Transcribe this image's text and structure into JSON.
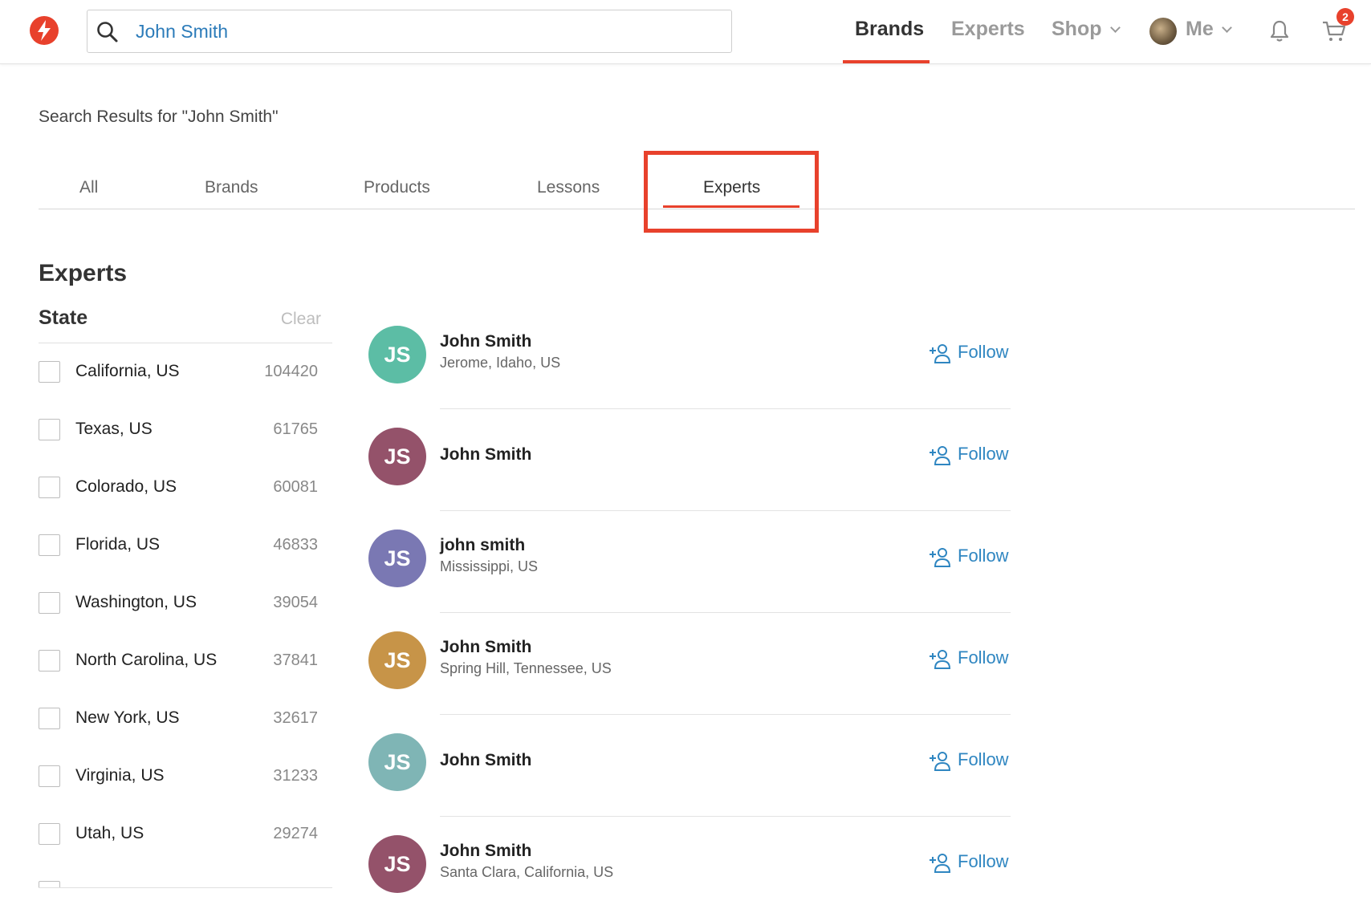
{
  "header": {
    "search_value": "John Smith",
    "nav": [
      "Brands",
      "Experts",
      "Shop",
      "Me"
    ],
    "cart_count": "2",
    "colors": {
      "accent": "#e8412c",
      "link": "#2f86c1"
    }
  },
  "results": {
    "title": "Search Results for \"John Smith\"",
    "tabs": [
      "All",
      "Brands",
      "Products",
      "Lessons",
      "Experts"
    ],
    "active_tab": "Experts"
  },
  "sidebar": {
    "section_title": "Experts",
    "filter_title": "State",
    "clear_label": "Clear",
    "states": [
      {
        "label": "California, US",
        "count": "104420"
      },
      {
        "label": "Texas, US",
        "count": "61765"
      },
      {
        "label": "Colorado, US",
        "count": "60081"
      },
      {
        "label": "Florida, US",
        "count": "46833"
      },
      {
        "label": "Washington, US",
        "count": "39054"
      },
      {
        "label": "North Carolina, US",
        "count": "37841"
      },
      {
        "label": "New York, US",
        "count": "32617"
      },
      {
        "label": "Virginia, US",
        "count": "31233"
      },
      {
        "label": "Utah, US",
        "count": "29274"
      }
    ]
  },
  "experts": [
    {
      "initials": "JS",
      "name": "John Smith",
      "location": "Jerome, Idaho, US",
      "color": "#5cbda5",
      "follow": "Follow"
    },
    {
      "initials": "JS",
      "name": "John Smith",
      "location": "",
      "color": "#94526a",
      "follow": "Follow"
    },
    {
      "initials": "JS",
      "name": "john smith",
      "location": "Mississippi, US",
      "color": "#7a78b3",
      "follow": "Follow"
    },
    {
      "initials": "JS",
      "name": "John Smith",
      "location": "Spring Hill, Tennessee, US",
      "color": "#c79448",
      "follow": "Follow"
    },
    {
      "initials": "JS",
      "name": "John Smith",
      "location": "",
      "color": "#7fb5b5",
      "follow": "Follow"
    },
    {
      "initials": "JS",
      "name": "John Smith",
      "location": "Santa Clara, California, US",
      "color": "#94526a",
      "follow": "Follow"
    }
  ]
}
